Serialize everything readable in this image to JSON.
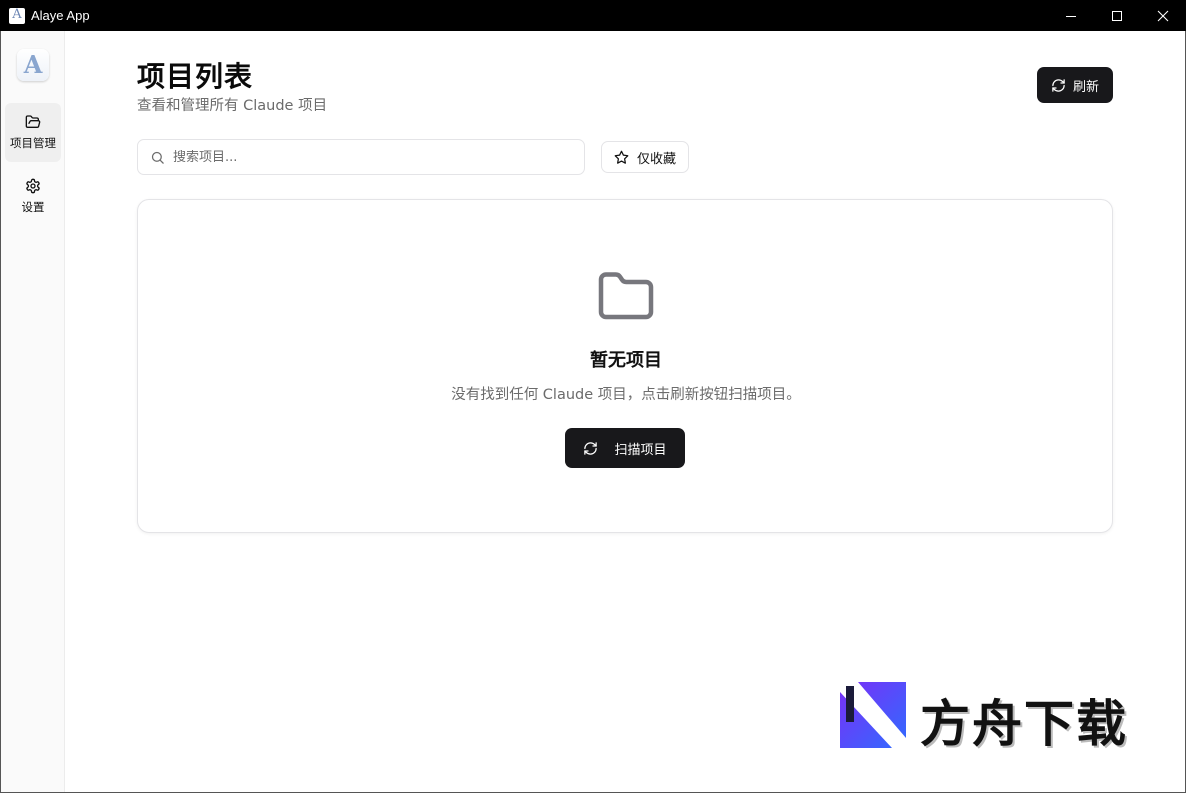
{
  "window": {
    "title": "Alaye App",
    "icon_letter": "A"
  },
  "sidebar": {
    "logo_letter": "A",
    "items": [
      {
        "label": "项目管理",
        "icon": "folder-open-icon",
        "active": true
      },
      {
        "label": "设置",
        "icon": "gear-icon",
        "active": false
      }
    ]
  },
  "header": {
    "title": "项目列表",
    "subtitle": "查看和管理所有 Claude 项目",
    "refresh_label": "刷新"
  },
  "search": {
    "placeholder": "搜索项目..."
  },
  "filter": {
    "favorites_label": "仅收藏"
  },
  "empty_state": {
    "title": "暂无项目",
    "description": "没有找到任何 Claude 项目，点击刷新按钮扫描项目。",
    "scan_label": "扫描项目"
  },
  "watermark": {
    "text": "方舟下载"
  },
  "colors": {
    "primary_button": "#18181b",
    "muted_text": "#6b6b6b",
    "border": "#e4e4e7"
  }
}
